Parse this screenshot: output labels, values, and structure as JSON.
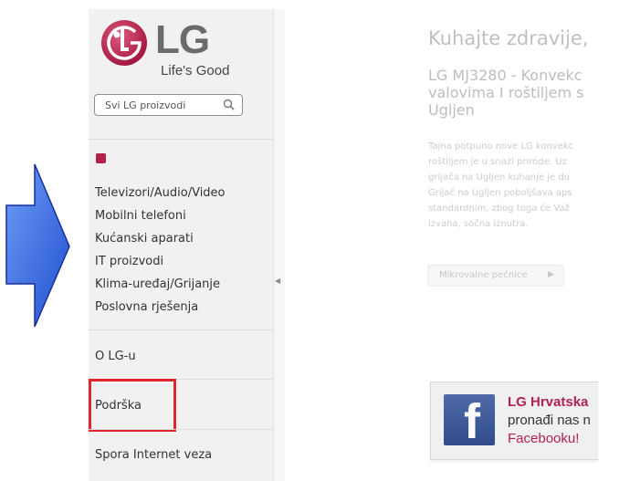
{
  "brand": {
    "logo_text": "LG",
    "tagline": "Life's Good",
    "logo_color": "#b4224c"
  },
  "search": {
    "placeholder": "Svi LG proizvodi",
    "icon": "search-icon"
  },
  "sidebar": {
    "category_icon_color": "#b4224c",
    "items": [
      {
        "label": "Televizori/Audio/Video"
      },
      {
        "label": "Mobilni telefoni"
      },
      {
        "label": "Kućanski aparati"
      },
      {
        "label": "IT proizvodi"
      },
      {
        "label": "Klima-uređaj/Grijanje"
      },
      {
        "label": "Poslovna rješenja"
      }
    ],
    "about": "O LG-u",
    "support": "Podrška",
    "slow_connection": "Spora Internet veza",
    "collapse_icon": "chevron-left-icon"
  },
  "main": {
    "title": "Kuhajte zdravije,",
    "product_title_lines": [
      "LG MJ3280 - Konvekc",
      "valovima I roštiljem s",
      "Ugljen"
    ],
    "body_lines": [
      "Tajna potpuno nove LG konvekc",
      "roštiljem je u snazi prirode. Uz",
      "grijača na Ugljen kuhanje je du",
      "Grijač na Ugljen poboljšava aps",
      "standardnim, zbog toga će Važ",
      "izvana, sočna iznutra."
    ],
    "category_button": "Mikrovalne pećnice"
  },
  "facebook": {
    "title": "LG Hrvatska",
    "line2": "pronađi nas n",
    "line3": "Facebooku!",
    "icon_letter": "f"
  },
  "annotations": {
    "highlight_color": "#e0252f",
    "arrow_color": "#2f63e0"
  }
}
